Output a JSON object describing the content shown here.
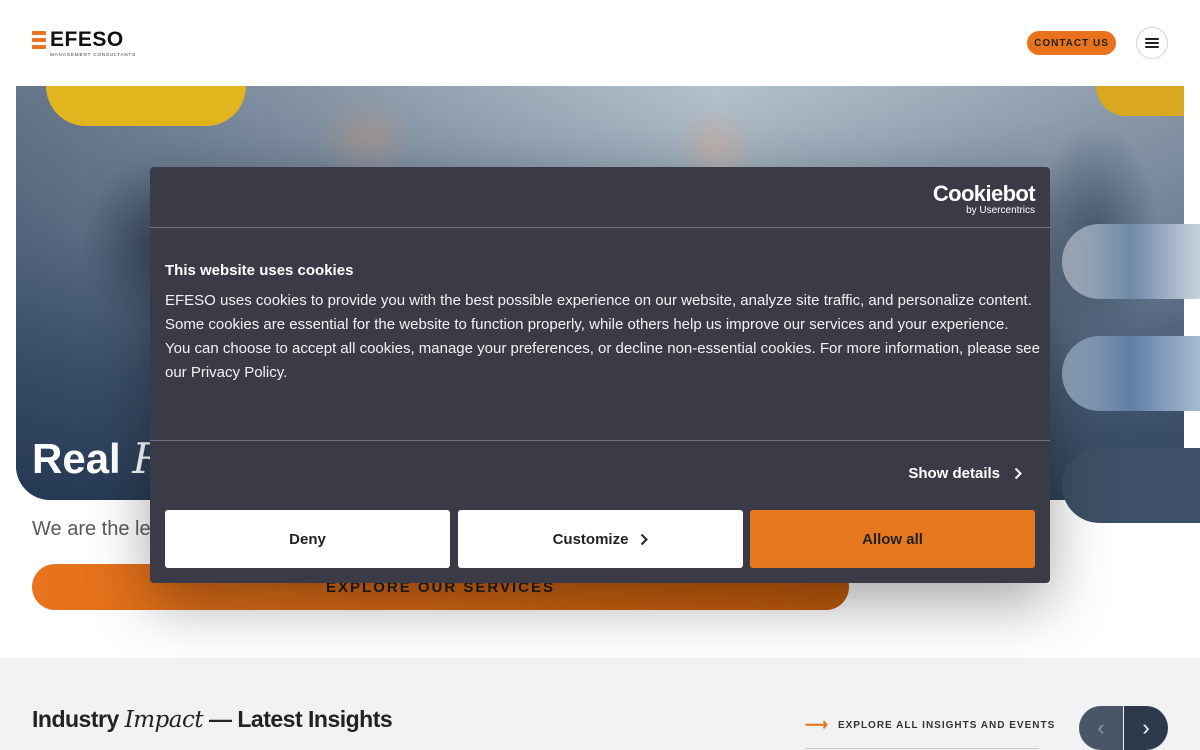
{
  "header": {
    "logo_word": "EFESO",
    "logo_sub": "MANAGEMENT CONSULTANTS",
    "contact_label": "CONTACT US",
    "menu_icon": "hamburger-icon"
  },
  "hero": {
    "title_plain": "Real ",
    "title_italic": "R",
    "description": "We are the le",
    "explore_label": "EXPLORE OUR SERVICES"
  },
  "insights": {
    "title_pre": "Industry ",
    "title_italic": "Impact",
    "title_post": " — Latest Insights",
    "explore_link": "EXPLORE ALL INSIGHTS AND EVENTS",
    "prev_icon": "chevron-left-icon",
    "next_icon": "chevron-right-icon"
  },
  "cookie_dialog": {
    "brand": "Cookiebot",
    "brand_sub": "by Usercentrics",
    "title": "This website uses cookies",
    "body_1": "EFESO uses cookies to provide you with the best possible experience on our website, analyze site traffic, and personalize content. Some cookies are essential for the website to function properly, while others help us improve our services and your experience.",
    "body_2": "You can choose to accept all cookies, manage your preferences, or decline non-essential cookies. For more information, please see our Privacy Policy.",
    "show_details": "Show details",
    "deny": "Deny",
    "customize": "Customize",
    "allow_all": "Allow all"
  },
  "colors": {
    "accent": "#e8731c",
    "dialog_bg": "#3b3b48"
  }
}
